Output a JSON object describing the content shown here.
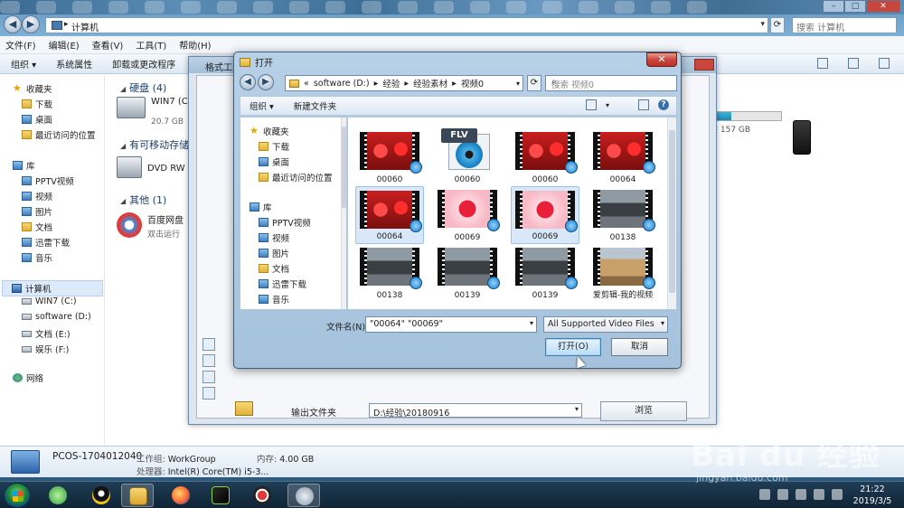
{
  "explorer": {
    "address": "计算机",
    "search_placeholder": "搜索 计算机",
    "menu": [
      "文件(F)",
      "编辑(E)",
      "查看(V)",
      "工具(T)",
      "帮助(H)"
    ],
    "toolbar": [
      "组织 ▾",
      "系统属性",
      "卸载或更改程序"
    ],
    "sidebar": {
      "favorites": "收藏夹",
      "fav_items": [
        "下载",
        "桌面",
        "最近访问的位置"
      ],
      "libraries": "库",
      "lib_items": [
        "PPTV视频",
        "视频",
        "图片",
        "文档",
        "迅雷下载",
        "音乐"
      ],
      "computer": "计算机",
      "drives": [
        "WIN7 (C:)",
        "software (D:)",
        "文档 (E:)",
        "娱乐 (F:)"
      ],
      "network": "网络"
    },
    "main": {
      "hdd_group": "硬盘 (4)",
      "drive_c_name": "WIN7 (C:)",
      "drive_c_free": "20.7 GB",
      "drive_right_free": "共 157 GB",
      "removable_group": "有可移动存储的",
      "dvd_name": "DVD RW",
      "other_group": "其他 (1)",
      "baidu_name": "百度网盘",
      "baidu_sub": "双击运行"
    },
    "details": {
      "pc_name": "PCOS-1704012040",
      "workgroup_label": "工作组:",
      "workgroup": "WorkGroup",
      "memory_label": "内存:",
      "memory": "4.00 GB",
      "cpu_label": "处理器:",
      "cpu": "Intel(R) Core(TM) i5-3..."
    }
  },
  "converter": {
    "title": "格式工",
    "output_label": "输出文件夹",
    "output_path": "D:\\经验\\20180916",
    "browse_label": "浏览"
  },
  "dialog": {
    "title": "打开",
    "path": [
      "«",
      "software (D:)",
      "▸",
      "经验",
      "▸",
      "经验素材",
      "▸",
      "视频0"
    ],
    "search_placeholder": "搜索 视频0",
    "toolbar": [
      "组织 ▾",
      "新建文件夹"
    ],
    "nav": {
      "favorites": "收藏夹",
      "fav_items": [
        "下载",
        "桌面",
        "最近访问的位置"
      ],
      "libraries": "库",
      "lib_items": [
        "PPTV视频",
        "视频",
        "图片",
        "文档",
        "迅雷下载",
        "音乐"
      ]
    },
    "files": [
      {
        "name": "00060",
        "kind": "red",
        "selected": false
      },
      {
        "name": "00060",
        "kind": "flv",
        "selected": false
      },
      {
        "name": "00060",
        "kind": "red",
        "selected": false
      },
      {
        "name": "00064",
        "kind": "red",
        "selected": false
      },
      {
        "name": "00064",
        "kind": "red",
        "selected": true
      },
      {
        "name": "00069",
        "kind": "pink",
        "selected": false
      },
      {
        "name": "00069",
        "kind": "pink",
        "selected": true
      },
      {
        "name": "00138",
        "kind": "car",
        "selected": false
      },
      {
        "name": "00138",
        "kind": "car",
        "selected": false
      },
      {
        "name": "00139",
        "kind": "car",
        "selected": false
      },
      {
        "name": "00139",
        "kind": "car",
        "selected": false
      },
      {
        "name": "爱剪辑-我的视频",
        "kind": "sand",
        "selected": false
      }
    ],
    "filename_label": "文件名(N):",
    "filename_value": "\"00064\" \"00069\"",
    "filetype": "All Supported Video Files",
    "open_label": "打开(O)",
    "cancel_label": "取消"
  },
  "taskbar": {
    "time": "21:22",
    "date": "2019/3/5"
  },
  "watermark": {
    "brand": "Bai du 经验",
    "url": "jingyan.baidu.com"
  },
  "colors": {
    "selection": "#d8e8f9",
    "accent": "#3c7fb1",
    "close": "#c9463d"
  }
}
